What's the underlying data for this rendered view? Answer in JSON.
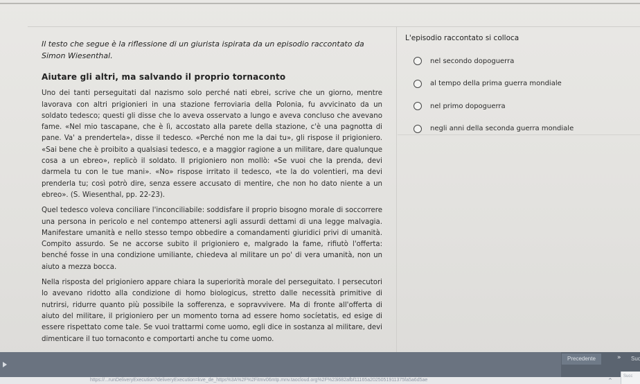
{
  "passage": {
    "intro": "Il testo che segue è la riflessione di un giurista ispirata da un episodio raccontato da Simon Wiesenthal.",
    "title": "Aiutare gli altri, ma salvando il proprio tornaconto",
    "paragraphs": [
      "Uno dei tanti perseguitati dal nazismo solo perché nati ebrei, scrive che un giorno, mentre lavorava con altri prigionieri in una stazione ferroviaria della Polonia, fu avvicinato da un soldato tedesco; questi gli disse che lo aveva osservato a lungo e aveva concluso che avevano fame. «Nel mio tascapane, che è lì, accostato alla parete della stazione, c'è una pagnotta di pane. Va' a prendertela», disse il tedesco. «Perché non me la dai tu», gli rispose il prigioniero. «Sai bene che è proibito a qualsiasi tedesco, e a maggior ragione a un militare, dare qualunque cosa a un ebreo», replicò il soldato. Il prigioniero non mollò: «Se vuoi che la prenda, devi darmela tu con le tue mani». «No» rispose irritato il tedesco, «te la do volentieri, ma devi prenderla tu; così potrò dire, senza essere accusato di mentire, che non ho dato niente a un ebreo». (S. Wiesenthal, pp. 22-23).",
      "Quel tedesco voleva conciliare l'inconciliabile: soddisfare il proprio bisogno morale di soccorrere una persona in pericolo e nel contempo attenersi agli assurdi dettami di una legge malvagia. Manifestare umanità e nello stesso tempo obbedire a comandamenti giuridici privi di umanità. Compito assurdo. Se ne accorse subito il prigioniero e, malgrado la fame, rifiutò l'offerta: benché fosse in una condizione umiliante, chiedeva al militare un po' di vera umanità, non un aiuto a mezza bocca.",
      "Nella risposta del prigioniero appare chiara la superiorità morale del perseguitato. I persecutori lo avevano ridotto alla condizione di homo biologicus, stretto dalle necessità primitive di nutrirsi, ridurre quanto più possibile la sofferenza, e sopravvivere. Ma di fronte all'offerta di aiuto del militare, il prigioniero per un momento torna ad essere homo socíetatis, ed esige di essere rispettato come tale. Se vuoi trattarmi come uomo, egli dice in sostanza al militare, devi dimenticare il tuo tornaconto e comportarti anche tu come uomo."
    ]
  },
  "question": {
    "title": "L'episodio raccontato si colloca",
    "options": [
      "nel secondo dopoguerra",
      "al tempo della prima guerra mondiale",
      "nel primo dopoguerra",
      "negli anni della seconda guerra mondiale"
    ]
  },
  "navigation": {
    "prev_label": "Precedente",
    "next_label": "Successivo",
    "next_icon": "double-chevron-right-icon"
  },
  "status": {
    "url": "https://...runDeliveryExecution?deliveryExecution=kve_de_https%3A%2F%2Fitmv06mtp.mnv.taocloud.org%2F%23i682afbf11165a2025051911375fa5a6d5ae",
    "right_label": "Succ"
  },
  "colors": {
    "background": "#e4e3e0",
    "bottom_bar": "#5b6470",
    "text": "#2a2a2a"
  }
}
